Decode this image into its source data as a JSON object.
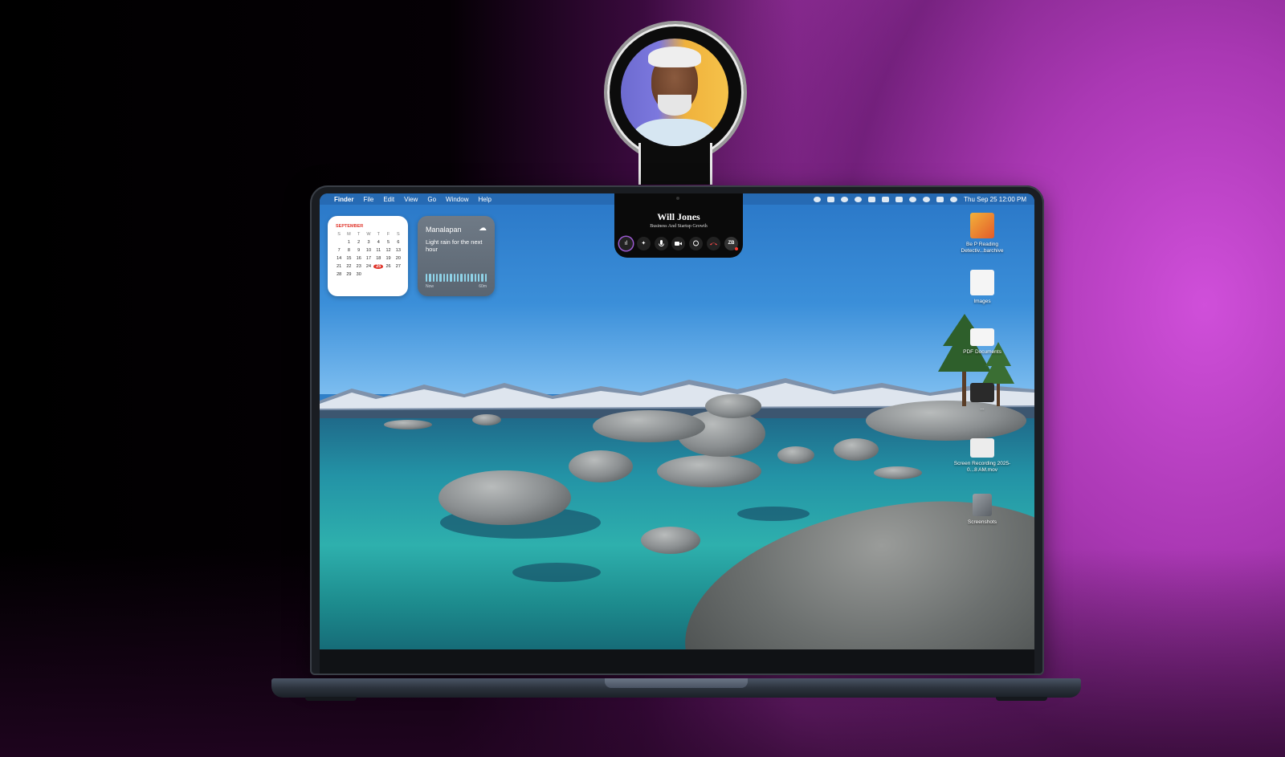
{
  "menubar": {
    "apple_glyph": "",
    "items": [
      "Finder",
      "File",
      "Edit",
      "View",
      "Go",
      "Window",
      "Help"
    ],
    "clock": "Thu Sep 25  12:00 PM"
  },
  "calendar_widget": {
    "month": "SEPTEMBER",
    "weekdays": [
      "S",
      "M",
      "T",
      "W",
      "T",
      "F",
      "S"
    ],
    "days": [
      "",
      "1",
      "2",
      "3",
      "4",
      "5",
      "6",
      "7",
      "8",
      "9",
      "10",
      "11",
      "12",
      "13",
      "14",
      "15",
      "16",
      "17",
      "18",
      "19",
      "20",
      "21",
      "22",
      "23",
      "24",
      "25",
      "26",
      "27",
      "28",
      "29",
      "30",
      "",
      "",
      "",
      ""
    ],
    "today": "25"
  },
  "weather_widget": {
    "city": "Manalapan",
    "description": "Light rain for the next hour",
    "axis_start": "Now",
    "axis_end": "60m",
    "icon": "cloud-rain-icon"
  },
  "desktop_items": [
    {
      "label": "Be P Reading Detectiv...barchive",
      "icon": "archive-file-icon",
      "color": "#e35b2a"
    },
    {
      "label": "Images",
      "icon": "folder-icon",
      "color": "#f2f2f2"
    },
    {
      "label": "PDF Documents",
      "icon": "pdf-folder-icon",
      "color": "#f2f2f2"
    },
    {
      "label": "...",
      "icon": "folder-icon",
      "color": "#2a2a2a"
    },
    {
      "label": "Screen Recording 2025-0...8 AM.mov",
      "icon": "video-file-icon",
      "color": "#e7e7e7"
    },
    {
      "label": "Screenshots",
      "icon": "screenshot-folder-icon",
      "color": "#7a7a7a"
    }
  ],
  "call_panel": {
    "name": "Will Jones",
    "subtitle": "Business And Startup Growth",
    "controls": [
      {
        "name": "app-icon",
        "glyph": "ıl"
      },
      {
        "name": "effects-icon",
        "glyph": "✦"
      },
      {
        "name": "microphone-icon",
        "glyph": "🎙"
      },
      {
        "name": "video-camera-icon",
        "glyph": "■"
      },
      {
        "name": "chat-bubble-icon",
        "glyph": "◌"
      },
      {
        "name": "end-call-icon",
        "glyph": "☎"
      },
      {
        "name": "user-avatar",
        "glyph": "ZB"
      }
    ]
  },
  "colors": {
    "accent_today": "#e0362c",
    "end_call": "#ff4a4a",
    "background_magenta": "#b23fba"
  }
}
